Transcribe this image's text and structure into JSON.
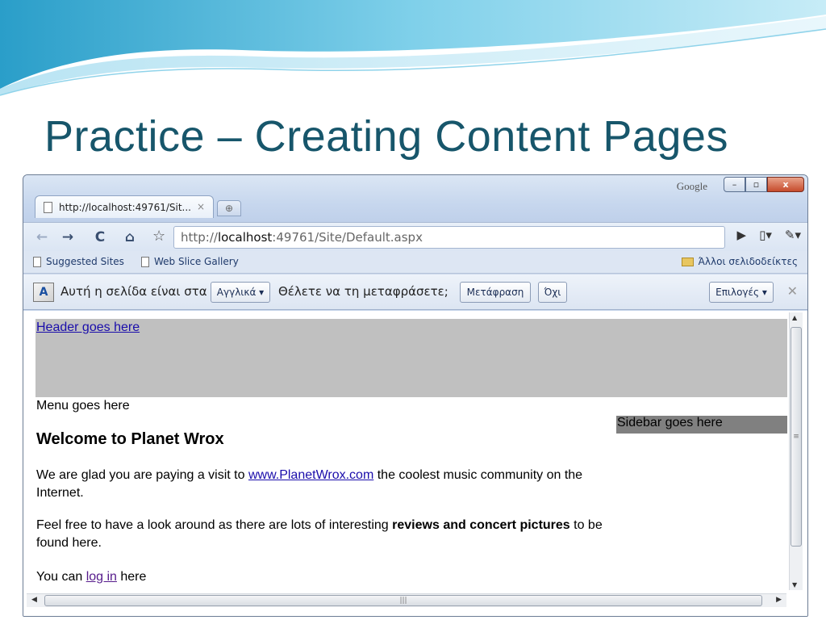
{
  "slide": {
    "title": "Practice – Creating Content Pages"
  },
  "browser": {
    "google_label": "Google",
    "window_buttons": {
      "minimize": "–",
      "maximize": "▫",
      "close": "x"
    },
    "tab": {
      "title": "http://localhost:49761/Sit...",
      "close": "×"
    },
    "address": {
      "scheme": "http://",
      "host": "localhost",
      "rest": ":49761/Site/Default.aspx"
    },
    "bookmarks": [
      {
        "label": "Suggested Sites"
      },
      {
        "label": "Web Slice Gallery"
      }
    ],
    "other_bookmarks": "Άλλοι σελιδοδείκτες",
    "translate_bar": {
      "prefix": "Αυτή η σελίδα είναι στα",
      "language": "Αγγλικά ▾",
      "question": "Θέλετε να τη μεταφράσετε;",
      "translate_button": "Μετάφραση",
      "no_button": "Όχι",
      "options_button": "Επιλογές ▾"
    }
  },
  "page": {
    "header_link": "Header goes here",
    "menu": "Menu goes here",
    "sidebar": "Sidebar goes here",
    "heading": "Welcome to Planet Wrox",
    "para1": {
      "before": "We are glad you are paying a visit to ",
      "link": "www.PlanetWrox.com",
      "after": " the coolest music community on the Internet."
    },
    "para2": {
      "before": "Feel free to have a look around as there are lots of interesting ",
      "bold": "reviews and concert pictures",
      "after": " to be found here."
    },
    "para3": {
      "before": "You can ",
      "link": "log in",
      "after": " here"
    }
  }
}
